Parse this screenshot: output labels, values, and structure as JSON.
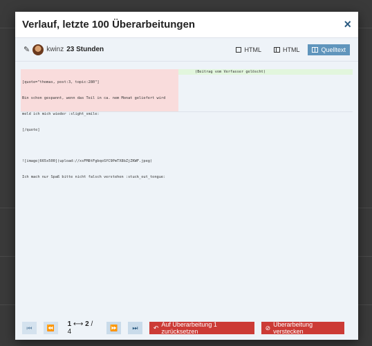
{
  "modal": {
    "title": "Verlauf, letzte 100 Überarbeitungen",
    "close_icon": "×"
  },
  "revision": {
    "username": "kwinz",
    "time": "23 Stunden"
  },
  "view_buttons": [
    {
      "label": "HTML",
      "icon": "box-icon",
      "active": false
    },
    {
      "label": "HTML",
      "icon": "columns-icon",
      "active": false
    },
    {
      "label": "Quelltext",
      "icon": "columns-icon",
      "active": true
    }
  ],
  "diff": {
    "left_lines": [
      "[quote=\"thomas, post:3, topic:280\"]",
      "Bin schon gespannt, wenn das Teil in ca. nem Monat geliefert wird",
      "meld ich mich wieder :slight_smile:",
      "[/quote]",
      "",
      "![image|665x500](upload://xsFM8tFgbqoSYC9PmTX8bZjZKWF.jpeg)",
      "Ich mach nur Spaß bitte nicht falsch verstehen :stuck_out_tongue:"
    ],
    "right_text": "(Beitrag vom Verfasser gelöscht)"
  },
  "pagination": {
    "current": "1",
    "arrow": "⟷",
    "next": "2",
    "total": "4"
  },
  "actions": {
    "revert": "Auf Überarbeitung 1 zurücksetzen",
    "hide": "Überarbeitung verstecken"
  },
  "colors": {
    "danger": "#cc3b36",
    "accent": "#5f95bc",
    "diff_removed": "#f9dcdc",
    "diff_added": "#e2f6dd"
  }
}
